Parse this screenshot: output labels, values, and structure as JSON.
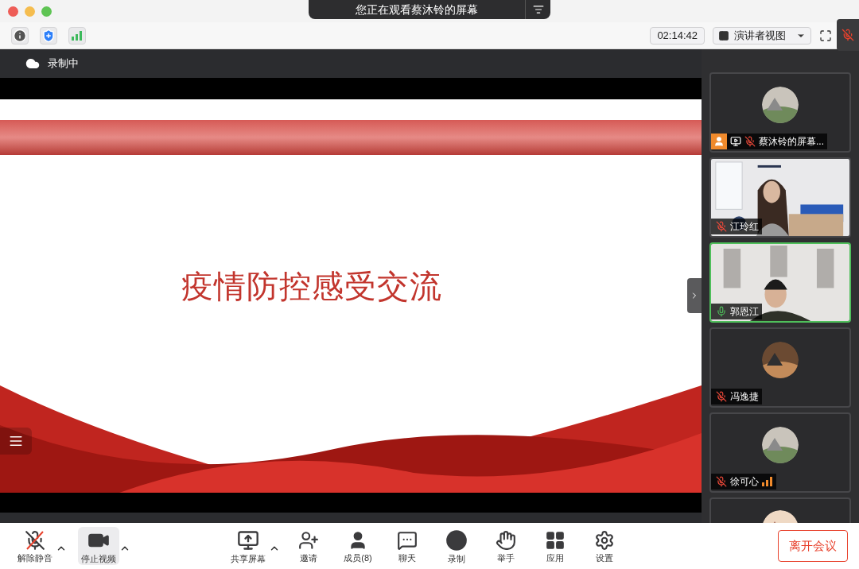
{
  "viewing_banner": {
    "label": "您正在观看蔡沐铃的屏幕"
  },
  "status_icons": [
    {
      "kind": "info"
    },
    {
      "kind": "shield"
    },
    {
      "kind": "signal"
    }
  ],
  "timer": "02:14:42",
  "view_menu": {
    "label": "演讲者视图"
  },
  "recording": {
    "label": "录制中"
  },
  "slide": {
    "title": "疫情防控感受交流"
  },
  "participants": [
    {
      "name": "蔡沐铃的屏幕...",
      "kind": "avatar",
      "muted": true,
      "speaking": false,
      "host": true,
      "sharing": true,
      "poor_connection": false
    },
    {
      "name": "江玲红",
      "kind": "video",
      "muted": true,
      "speaking": false,
      "host": false,
      "sharing": false,
      "poor_connection": false
    },
    {
      "name": "郭恩江",
      "kind": "video",
      "muted": false,
      "speaking": true,
      "host": false,
      "sharing": false,
      "poor_connection": false
    },
    {
      "name": "冯逸捷",
      "kind": "avatar",
      "muted": true,
      "speaking": false,
      "host": false,
      "sharing": false,
      "poor_connection": false
    },
    {
      "name": "徐可心",
      "kind": "avatar",
      "muted": true,
      "speaking": false,
      "host": false,
      "sharing": false,
      "poor_connection": true
    },
    {
      "kind": "avatar_partial"
    }
  ],
  "left_buttons": [
    {
      "kind": "mic",
      "label": "解除静音",
      "caret": true,
      "highlighted": false
    },
    {
      "kind": "video",
      "label": "停止视频",
      "caret": true,
      "highlighted": true
    }
  ],
  "center_buttons": [
    {
      "kind": "share",
      "label": "共享屏幕",
      "caret": true,
      "highlighted": false
    },
    {
      "kind": "invite",
      "label": "邀请",
      "caret": false,
      "highlighted": false
    },
    {
      "kind": "members",
      "label": "成员(8)",
      "caret": false,
      "highlighted": false
    },
    {
      "kind": "chat",
      "label": "聊天",
      "caret": false,
      "highlighted": false
    },
    {
      "kind": "record",
      "label": "录制",
      "caret": false,
      "highlighted": false
    },
    {
      "kind": "hand",
      "label": "举手",
      "caret": false,
      "highlighted": false
    },
    {
      "kind": "apps",
      "label": "应用",
      "caret": false,
      "highlighted": false
    },
    {
      "kind": "settings",
      "label": "设置",
      "caret": false,
      "highlighted": false
    }
  ],
  "leave_button": {
    "label": "离开会议"
  }
}
